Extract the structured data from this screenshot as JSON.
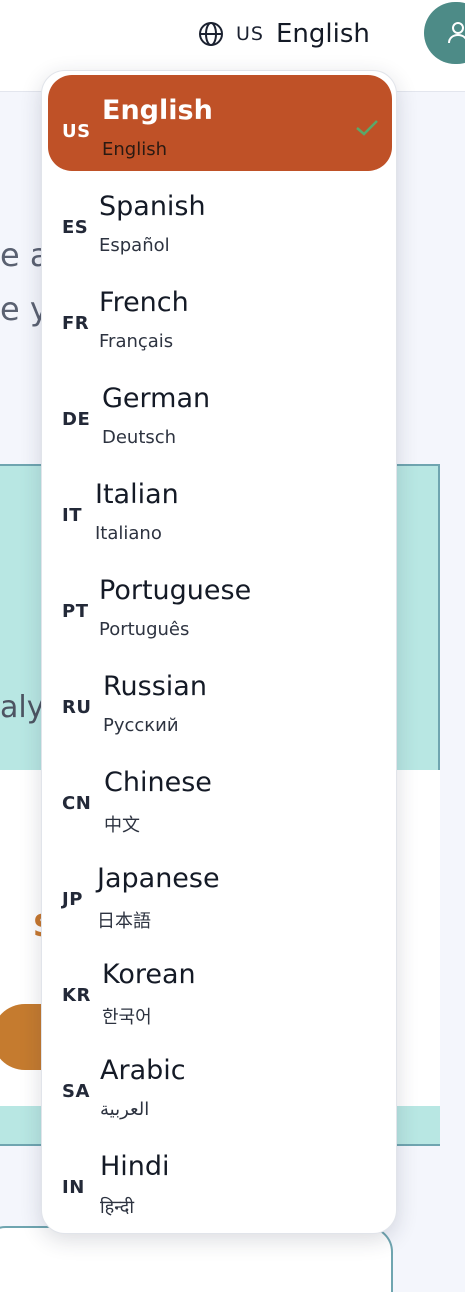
{
  "header": {
    "language_trigger": {
      "icon": "globe-icon",
      "code": "US",
      "label": "English"
    },
    "avatar": {
      "icon": "user-icon"
    }
  },
  "background": {
    "line1": "e a",
    "line2": "e yo",
    "teal_text": "aly",
    "accent_letter": "S"
  },
  "dropdown": {
    "selected_check_icon": "check-icon",
    "options": [
      {
        "code": "US",
        "name": "English",
        "native": "English",
        "selected": true
      },
      {
        "code": "ES",
        "name": "Spanish",
        "native": "Español"
      },
      {
        "code": "FR",
        "name": "French",
        "native": "Français"
      },
      {
        "code": "DE",
        "name": "German",
        "native": "Deutsch"
      },
      {
        "code": "IT",
        "name": "Italian",
        "native": "Italiano"
      },
      {
        "code": "PT",
        "name": "Portuguese",
        "native": "Português"
      },
      {
        "code": "RU",
        "name": "Russian",
        "native": "Русский"
      },
      {
        "code": "CN",
        "name": "Chinese",
        "native": "中文"
      },
      {
        "code": "JP",
        "name": "Japanese",
        "native": "日本語"
      },
      {
        "code": "KR",
        "name": "Korean",
        "native": "한국어"
      },
      {
        "code": "SA",
        "name": "Arabic",
        "native": "العربية"
      },
      {
        "code": "IN",
        "name": "Hindi",
        "native": "हिन्दी"
      }
    ]
  },
  "colors": {
    "selected_bg": "#bf5127",
    "check": "#5aa86a",
    "teal": "#b8e7e3",
    "avatar": "#4d8b87",
    "orange": "#c57b2f"
  }
}
